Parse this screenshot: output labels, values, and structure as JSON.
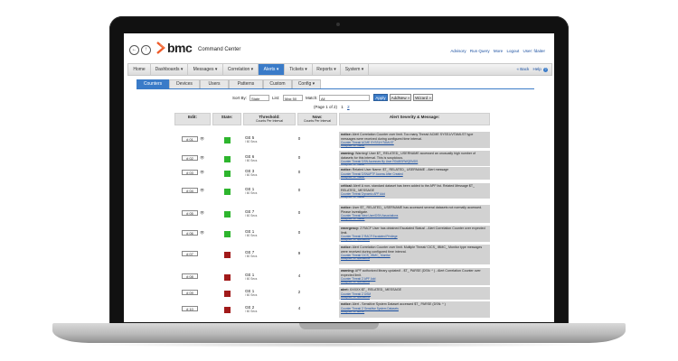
{
  "header": {
    "brand": "bmc",
    "product": "Command Center",
    "user_links": [
      "Advisory",
      "Run Query",
      "More",
      "Logout",
      "User: fdaiter"
    ]
  },
  "menu": {
    "tabs": [
      "Home",
      "Dashboards ▾",
      "Messages ▾",
      "Correlation ▾",
      "Alerts ▾",
      "Tickets ▾",
      "Reports ▾",
      "System ▾"
    ],
    "active_index": 4,
    "right_links": [
      "« Back",
      "Help"
    ]
  },
  "subtabs": {
    "items": [
      "Counters",
      "Devices",
      "Users",
      "Patterns",
      "Custom",
      "Config ▾"
    ],
    "active_index": 0
  },
  "filters": {
    "sort_label": "Sort By:",
    "sort_value": "State",
    "list_label": "List:",
    "list_value": "Max 50",
    "match_label": "Match:",
    "match_value": "All",
    "apply_label": "Apply",
    "addnew_label": "AddNew »",
    "wizard_label": "Wizard »"
  },
  "pagination": {
    "text": "(Page 1 of 2)",
    "p1": "1",
    "p2": "2"
  },
  "table": {
    "headers": {
      "edit": "Edit:",
      "state": "State:",
      "threshold": "Threshold:",
      "threshold_sub": "Counts Per Interval",
      "now": "Now:",
      "now_sub": "Counts Per Interval",
      "message": "Alert Severity & Message:"
    },
    "rows": [
      {
        "id": "# 01",
        "state": "#2db52d",
        "threshold": "GE 5",
        "interval": "/ 60 Secs",
        "now": "0",
        "severity": "notice:",
        "text": "Alert Correlation Counter over limit. Too many Threat/ ACME SYSS1/VTAMLST type messages were received during configured time interval.",
        "link": "Counter Threat/ ACME SYSS1/VTAMLST",
        "assigned": "Assigned To: rdaiter"
      },
      {
        "id": "# 02",
        "state": "#2db52d",
        "threshold": "GE 6",
        "interval": "/ 60 Secs",
        "now": "0",
        "severity": "warning:",
        "text": "Warning! User $T_ RELATED_ USERNAME accessed an unusually high number of datasets for this interval. This is suspicious.",
        "link": "Counter Threat/ DSN Accesses By User RDABSRWQEMDS",
        "assigned": "Assigned To: rdaiter"
      },
      {
        "id": "# 03",
        "state": "#2db52d",
        "threshold": "GE 3",
        "interval": "/ 60 Secs",
        "now": "0",
        "severity": "notice:",
        "text": "Related User Name: $T_ RELATED_ USERNAME - Alert message",
        "link": "Counter Threat/ DSNAPTF Access After Created",
        "assigned": "Assigned To: rdaiter"
      },
      {
        "id": "# 04",
        "state": "#2db52d",
        "threshold": "GE 1",
        "interval": "/ 60 Secs",
        "now": "0",
        "severity": "critical:",
        "text": "Alert! A non- standard dataset has been added to the APF list. Related Message $T_ RELATED_ MESSAGE",
        "link": "Counter Threat/ Dynamic APF Add",
        "assigned": "Assigned To: rdaiter"
      },
      {
        "id": "# 05",
        "state": "#2db52d",
        "threshold": "GE 7",
        "interval": "/ 60 Secs",
        "now": "0",
        "severity": "notice:",
        "text": "User $T_ RELATED_ USERNAME has accessed several datasets not normally accessed. Please investigate.",
        "link": "Counter Threat/ New User/DSN Associations",
        "assigned": "Assigned To: rdaiter"
      },
      {
        "id": "# 06",
        "state": "#2db52d",
        "threshold": "GE 1",
        "interval": "/ 60 Secs",
        "now": "0",
        "severity": "emergency:",
        "text": "Z RACF User has obtained Escalated Status! - Alert Correlation Counter over expected limit.",
        "link": "Counter Threat/ Z RACF Escalated Privilege",
        "assigned": "Assigned To: operations"
      },
      {
        "id": "# 07",
        "state": "#a11a1a",
        "threshold": "GE 7",
        "interval": "/ 60 Secs",
        "now": "9",
        "severity": "notice:",
        "text": "Alert Correlation Counter over limit. Multiple Threat/ CICS_ IBMC_ Monitor type messages were received during configured time interval.",
        "link": "Counter Threat/ CICS_ IBMC_ Monitor",
        "assigned": "Assigned To: operations"
      },
      {
        "id": "# 08",
        "state": "#a11a1a",
        "threshold": "GE 1",
        "interval": "/ 60 Secs",
        "now": "4",
        "severity": "warning:",
        "text": "APF authorized library updated! - $T_ PARSE (DSN: * ) - Alert Correlation Counter over expected limit.",
        "link": "Counter Threat/ Z APF Add",
        "assigned": "Assigned To: operations"
      },
      {
        "id": "# 09",
        "state": "#a11a1a",
        "threshold": "GE 1",
        "interval": "/ 60 Secs",
        "now": "2",
        "severity": "alert:",
        "text": "XXXXX $T_ RELATED_ MESSAGE",
        "link": "Counter Threat/ Z DSM",
        "assigned": "Assigned To: operations"
      },
      {
        "id": "# 10",
        "state": "#a11a1a",
        "threshold": "GE 2",
        "interval": "/ 60 Secs",
        "now": "4",
        "severity": "notice:",
        "text": "Alert - Sensitive System Dataset accessed $T_ PARSE (DSN: * )",
        "link": "Counter Threat/ Z Sensitive System Datasets",
        "assigned": "Assigned To: admin"
      }
    ]
  }
}
